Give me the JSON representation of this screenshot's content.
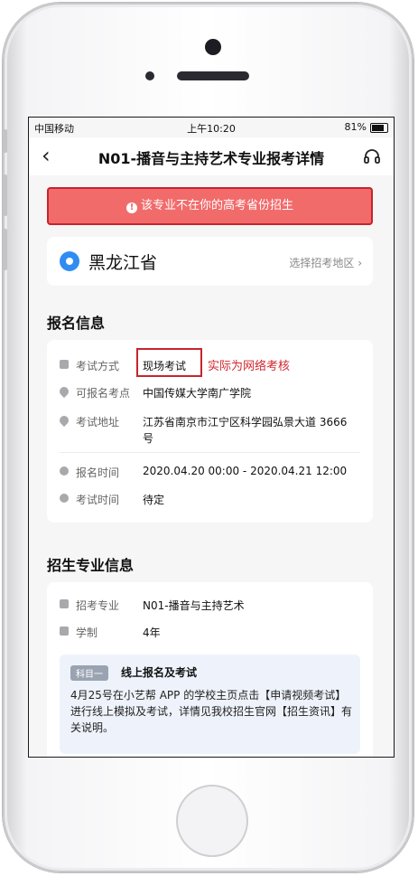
{
  "status_bar": {
    "carrier": "中国移动",
    "time": "上午10:20",
    "battery": "81%"
  },
  "nav": {
    "back_icon": "‹",
    "title": "N01-播音与主持艺术专业报考详情",
    "support_icon": "headset-icon"
  },
  "alert": {
    "icon": "!",
    "text": "该专业不在你的高考省份招生"
  },
  "region": {
    "province": "黑龙江省",
    "select_label": "选择招考地区 ›"
  },
  "registration": {
    "section_title": "报名信息",
    "exam_method_label": "考试方式",
    "exam_method_value": "现场考试",
    "annotation": "实际为网络考核",
    "site_label": "可报名考点",
    "site_value": "中国传媒大学南广学院",
    "address_label": "考试地址",
    "address_value_line1": "江苏省南京市江宁区科学园弘景大道 3666",
    "address_value_line2": "号",
    "reg_time_label": "报名时间",
    "reg_time_value": "2020.04.20 00:00 - 2020.04.21 12:00",
    "exam_time_label": "考试时间",
    "exam_time_value": "待定"
  },
  "major_info": {
    "section_title": "招生专业信息",
    "major_label": "招考专业",
    "major_value": "N01-播音与主持艺术",
    "duration_label": "学制",
    "duration_value": "4年",
    "subject_tag": "科目一",
    "subject_title": "线上报名及考试",
    "subject_desc": "4月25号在小艺帮 APP 的学校主页点击【申请视频考试】进行线上模拟及考试，详情见我校招生官网【招生资讯】有关说明。"
  }
}
